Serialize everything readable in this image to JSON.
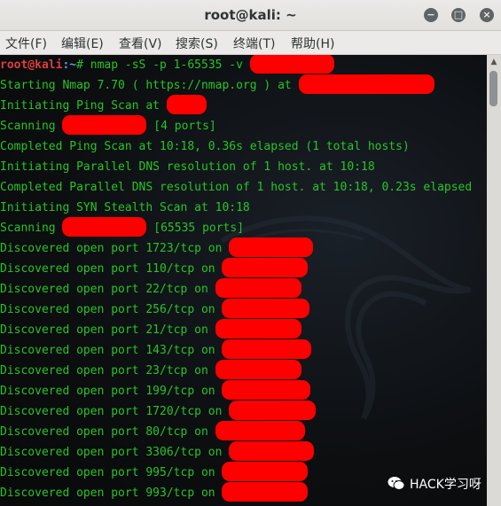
{
  "window": {
    "title": "root@kali: ~",
    "minimize_glyph": "−",
    "maximize_glyph": "□",
    "close_glyph": "×"
  },
  "menu": [
    "文件(F)",
    "编辑(E)",
    "查看(V)",
    "搜索(S)",
    "终端(T)",
    "帮助(H)"
  ],
  "prompt": {
    "user": "root@kali",
    "path": ":~",
    "symbol": "#",
    "command": " nmap -sS -p 1-65535 -v "
  },
  "lines": {
    "starting": "Starting Nmap 7.70 ( https://nmap.org ) at ",
    "init_ping": "Initiating Ping Scan at ",
    "scanning1_a": "Scanning ",
    "scanning1_b": " [4 ports]",
    "completed_ping": "Completed Ping Scan at 10:18, 0.36s elapsed (1 total hosts)",
    "init_dns": "Initiating Parallel DNS resolution of 1 host. at 10:18",
    "completed_dns": "Completed Parallel DNS resolution of 1 host. at 10:18, 0.23s elapsed",
    "init_syn": "Initiating SYN Stealth Scan at 10:18",
    "scanning2_a": "Scanning ",
    "scanning2_b": " [65535 ports]"
  },
  "discovered": [
    "Discovered open port 1723/tcp on ",
    "Discovered open port 110/tcp on ",
    "Discovered open port 22/tcp on ",
    "Discovered open port 256/tcp on ",
    "Discovered open port 21/tcp on ",
    "Discovered open port 143/tcp on ",
    "Discovered open port 23/tcp on ",
    "Discovered open port 199/tcp on ",
    "Discovered open port 1720/tcp on ",
    "Discovered open port 80/tcp on ",
    "Discovered open port 3306/tcp on ",
    "Discovered open port 995/tcp on ",
    "Discovered open port 993/tcp on "
  ],
  "watermark": "HACK学习呀",
  "colors": {
    "terminal_text": "#27c427",
    "redaction": "#ff0000",
    "prompt_user": "#e03c3c",
    "prompt_path": "#5ea4d8"
  }
}
